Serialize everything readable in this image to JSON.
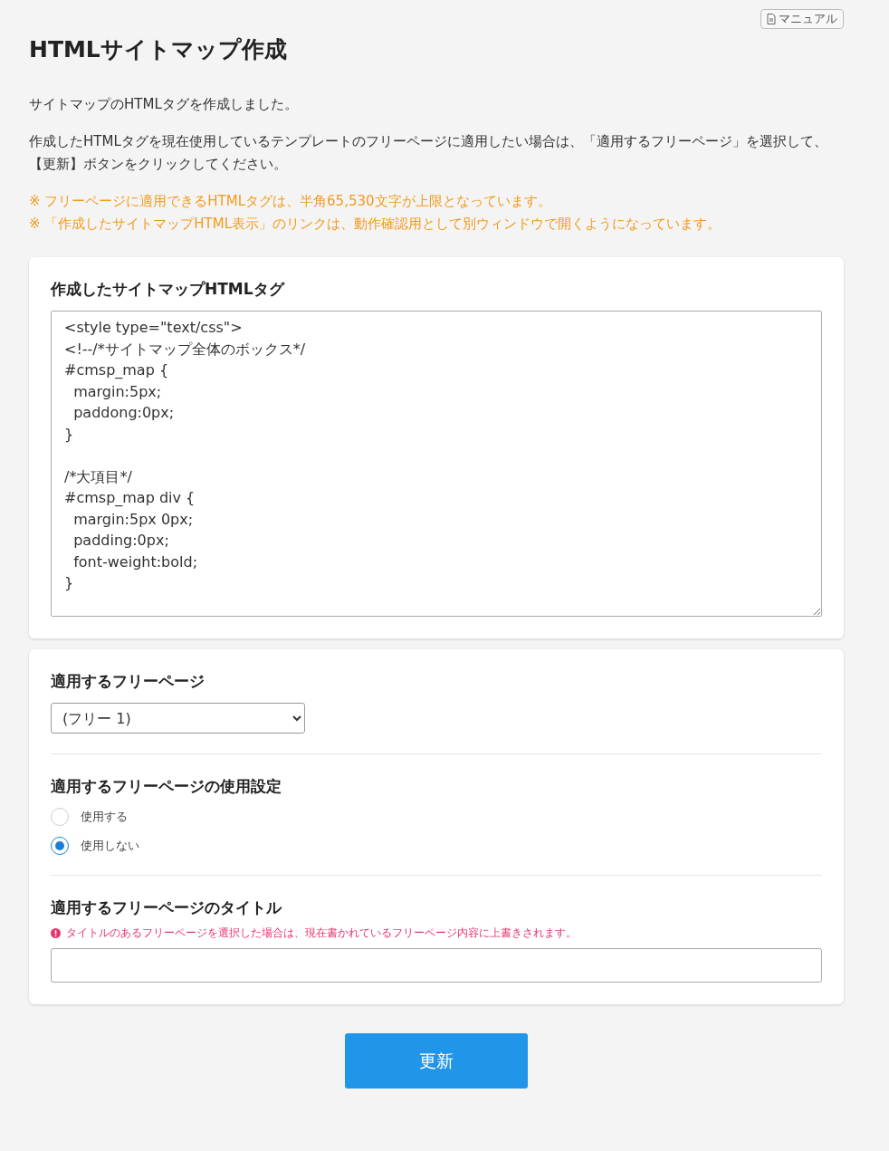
{
  "manual_button": {
    "label": "マニュアル"
  },
  "title": "HTMLサイトマップ作成",
  "intro": [
    {
      "lines": [
        "サイトマップのHTMLタグを作成しました。"
      ]
    },
    {
      "lines": [
        "作成したHTMLタグを現在使用しているテンプレートのフリーページに適用したい場合は、「適用するフリーページ」を選択して、",
        "【更新】ボタンをクリックしてください。"
      ]
    }
  ],
  "notes": [
    "※ フリーページに適用できるHTMLタグは、半角65,530文字が上限となっています。",
    "※ 「作成したサイトマップHTML表示」のリンクは、動作確認用として別ウィンドウで開くようになっています。"
  ],
  "html_section": {
    "heading": "作成したサイトマップHTMLタグ",
    "value": "<style type=\"text/css\">\n<!--/*サイトマップ全体のボックス*/\n#cmsp_map {\n  margin:5px;\n  paddong:0px;\n}\n\n/*大項目*/\n#cmsp_map div {\n  margin:5px 0px;\n  padding:0px;\n  font-weight:bold;\n}\n"
  },
  "page_section": {
    "heading": "適用するフリーページ",
    "select_value": "(フリー 1)"
  },
  "usage_section": {
    "heading": "適用するフリーページの使用設定",
    "options": [
      {
        "label": "使用する",
        "selected": false
      },
      {
        "label": "使用しない",
        "selected": true
      }
    ]
  },
  "title_section": {
    "heading": "適用するフリーページのタイトル",
    "warning": "タイトルのあるフリーページを選択した場合は、現在書かれているフリーページ内容に上書きされます。"
  },
  "submit_button": {
    "label": "更新"
  }
}
